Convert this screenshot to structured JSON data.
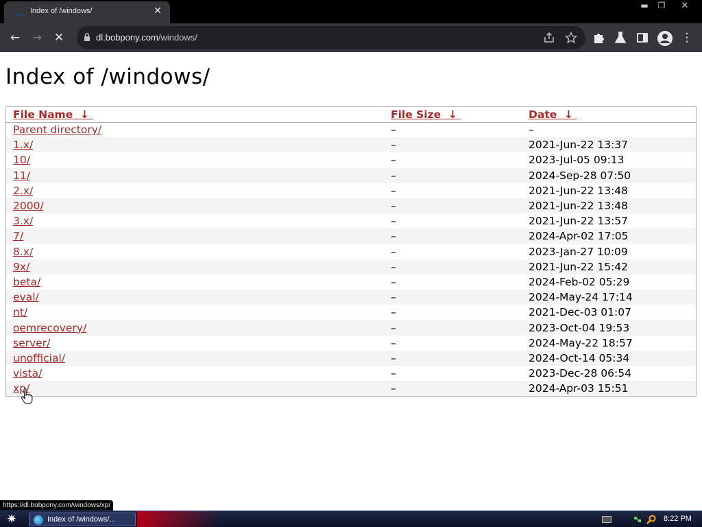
{
  "browser": {
    "tab": {
      "title": "Index of /windows/",
      "close_glyph": "✕"
    },
    "window_controls": {
      "minimize": "▬",
      "maximize": "❐",
      "close": "✕"
    },
    "toolbar": {
      "back_glyph": "←",
      "forward_glyph": "→",
      "stop_glyph": "✕",
      "url_host": "dl.bobpony.com",
      "url_path": "/windows/",
      "menu_glyph": "⋮"
    },
    "status_url": "https://dl.bobpony.com/windows/xp/"
  },
  "page": {
    "title": "Index of /windows/",
    "columns": {
      "name": "File Name",
      "size": "File Size",
      "date": "Date",
      "sort_glyph": "↓"
    },
    "rows": [
      {
        "name": "Parent directory/",
        "size": "–",
        "date": "–"
      },
      {
        "name": "1.x/",
        "size": "–",
        "date": "2021-Jun-22 13:37"
      },
      {
        "name": "10/",
        "size": "–",
        "date": "2023-Jul-05 09:13"
      },
      {
        "name": "11/",
        "size": "–",
        "date": "2024-Sep-28 07:50"
      },
      {
        "name": "2.x/",
        "size": "–",
        "date": "2021-Jun-22 13:48"
      },
      {
        "name": "2000/",
        "size": "–",
        "date": "2021-Jun-22 13:48"
      },
      {
        "name": "3.x/",
        "size": "–",
        "date": "2021-Jun-22 13:57"
      },
      {
        "name": "7/",
        "size": "–",
        "date": "2024-Apr-02 17:05"
      },
      {
        "name": "8.x/",
        "size": "–",
        "date": "2023-Jan-27 10:09"
      },
      {
        "name": "9x/",
        "size": "–",
        "date": "2021-Jun-22 15:42"
      },
      {
        "name": "beta/",
        "size": "–",
        "date": "2024-Feb-02 05:29"
      },
      {
        "name": "eval/",
        "size": "–",
        "date": "2024-May-24 17:14"
      },
      {
        "name": "nt/",
        "size": "–",
        "date": "2021-Dec-03 01:07"
      },
      {
        "name": "oemrecovery/",
        "size": "–",
        "date": "2023-Oct-04 19:53"
      },
      {
        "name": "server/",
        "size": "–",
        "date": "2024-May-22 18:57"
      },
      {
        "name": "unofficial/",
        "size": "–",
        "date": "2024-Oct-14 05:34"
      },
      {
        "name": "vista/",
        "size": "–",
        "date": "2023-Dec-28 06:54"
      },
      {
        "name": "xp/",
        "size": "–",
        "date": "2024-Apr-03 15:51"
      }
    ]
  },
  "taskbar": {
    "start_glyph": "✷",
    "task_label": "Index of /windows/...",
    "clock": "8:22 PM"
  },
  "colors": {
    "link": "#a52a2a",
    "alt_row": "#f4f4f4",
    "chrome_dark": "#35363a",
    "taskbar": "#1e2744"
  }
}
